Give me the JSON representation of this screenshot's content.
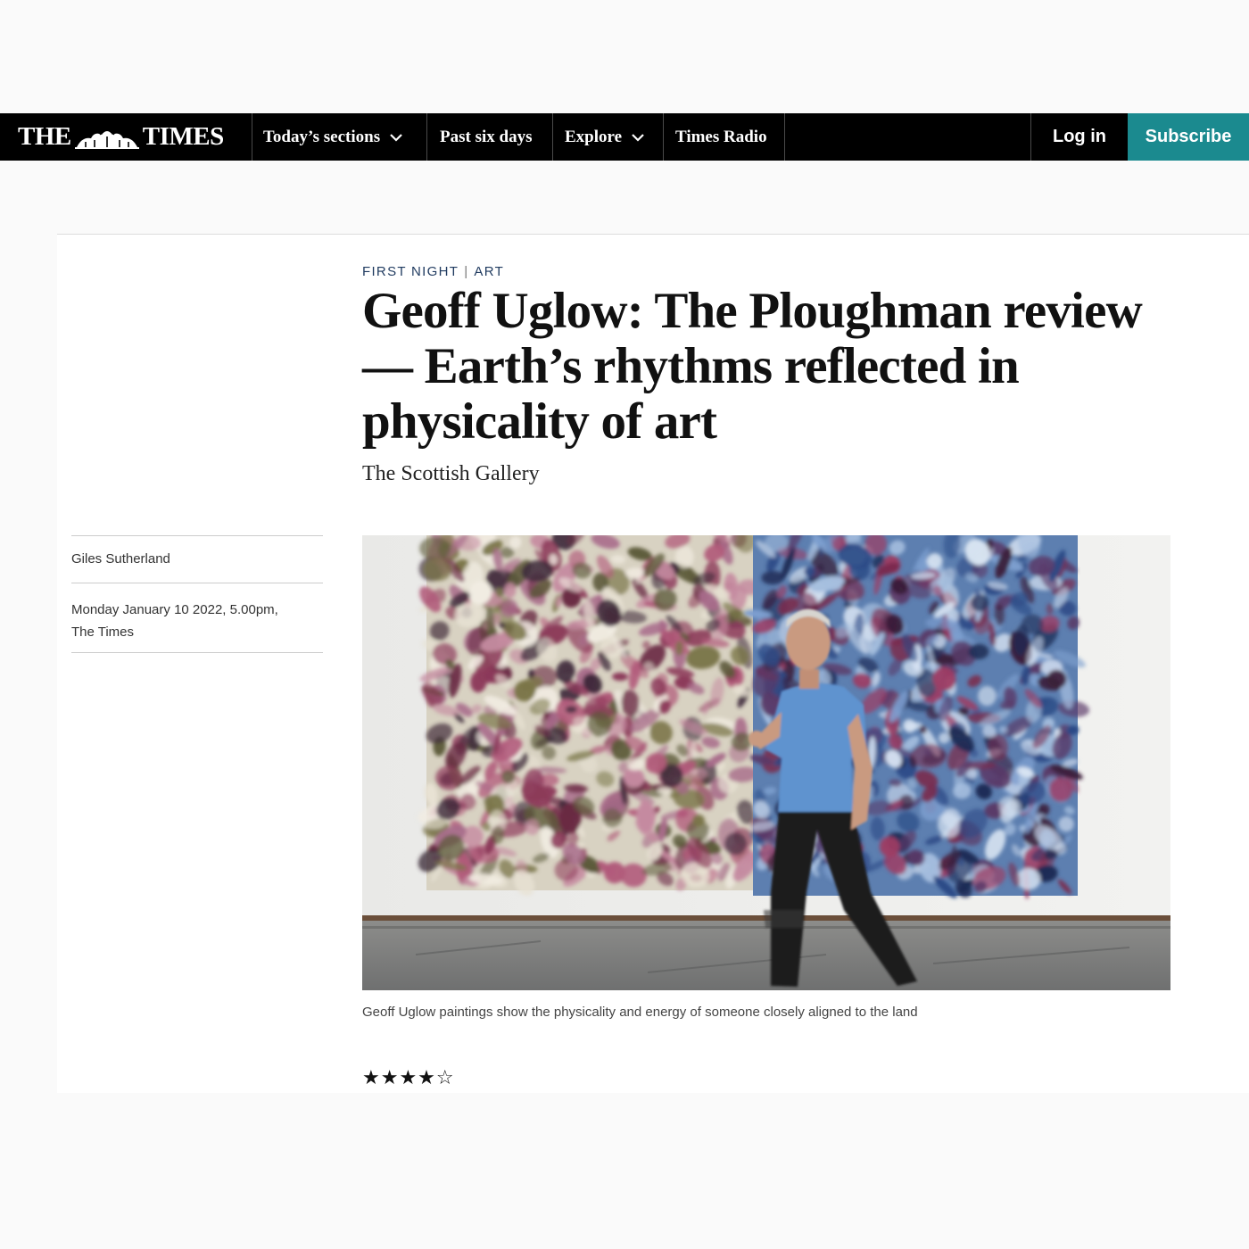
{
  "nav": {
    "logo_left": "THE",
    "logo_right": "TIMES",
    "items": [
      {
        "label": "Today’s sections",
        "has_dropdown": true
      },
      {
        "label": "Past six days",
        "has_dropdown": false
      },
      {
        "label": "Explore",
        "has_dropdown": true
      },
      {
        "label": "Times Radio",
        "has_dropdown": false
      }
    ],
    "login_label": "Log in",
    "subscribe_label": "Subscribe",
    "colors": {
      "bar": "#000000",
      "subscribe": "#1b8a8f"
    }
  },
  "article": {
    "section": "FIRST NIGHT",
    "subsection": "ART",
    "kicker_separator": "|",
    "headline": "Geoff Uglow: The Ploughman review — Earth’s rhythms reflected in physicality of art",
    "standfirst": "The Scottish Gallery",
    "author": "Giles Sutherland",
    "date": "Monday January 10 2022, 5.00pm,",
    "publication": "The Times",
    "image": {
      "description": "chevron-down-icon"
    },
    "caption": "Geoff Uglow paintings show the physicality and energy of someone closely aligned to the land",
    "rating": {
      "stars": 4,
      "max": 5,
      "display": "★★★★☆"
    }
  }
}
